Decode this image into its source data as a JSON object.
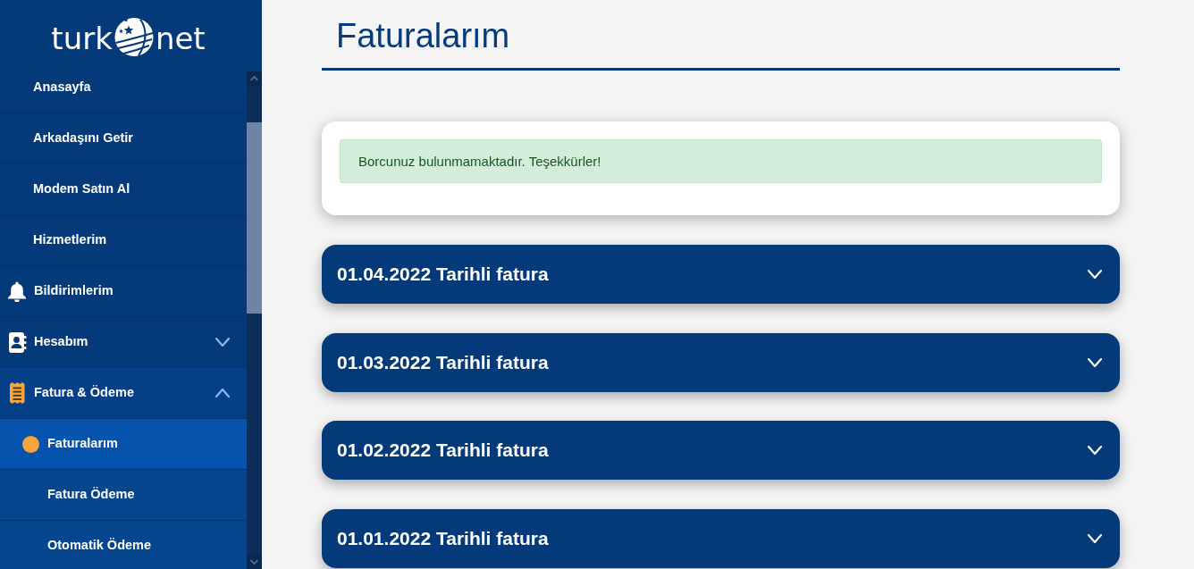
{
  "sidebar": {
    "logo": {
      "word_1": "turk",
      "word_2": "net"
    },
    "items": [
      {
        "kind": "link",
        "label": "Anasayfa",
        "selected": false
      },
      {
        "kind": "link",
        "label": "Arkadaşını Getir",
        "selected": false
      },
      {
        "kind": "link",
        "label": "Modem Satın Al",
        "selected": false
      },
      {
        "kind": "link",
        "label": "Hizmetlerim",
        "selected": false
      },
      {
        "kind": "notifications",
        "label": "Bildirimlerim",
        "selected": false
      },
      {
        "kind": "account",
        "label": "Hesabım",
        "selected": false,
        "expanded": false
      },
      {
        "kind": "billing",
        "label": "Fatura & Ödeme",
        "selected": false,
        "expanded": true,
        "children": [
          {
            "label": "Faturalarım",
            "selected": true
          },
          {
            "label": "Fatura Ödeme",
            "selected": false
          },
          {
            "label": "Otomatik Ödeme",
            "selected": false
          }
        ]
      }
    ]
  },
  "page": {
    "title": "Faturalarım"
  },
  "alert": {
    "kind": "success",
    "text": "Borcunuz bulunmamaktadır. Teşekkürler!"
  },
  "invoices": [
    {
      "title": "01.04.2022 Tarihli fatura",
      "expanded": false
    },
    {
      "title": "01.03.2022 Tarihli fatura",
      "expanded": false
    },
    {
      "title": "01.02.2022 Tarihli fatura",
      "expanded": false
    },
    {
      "title": "01.01.2022 Tarihli fatura",
      "expanded": false
    }
  ]
}
